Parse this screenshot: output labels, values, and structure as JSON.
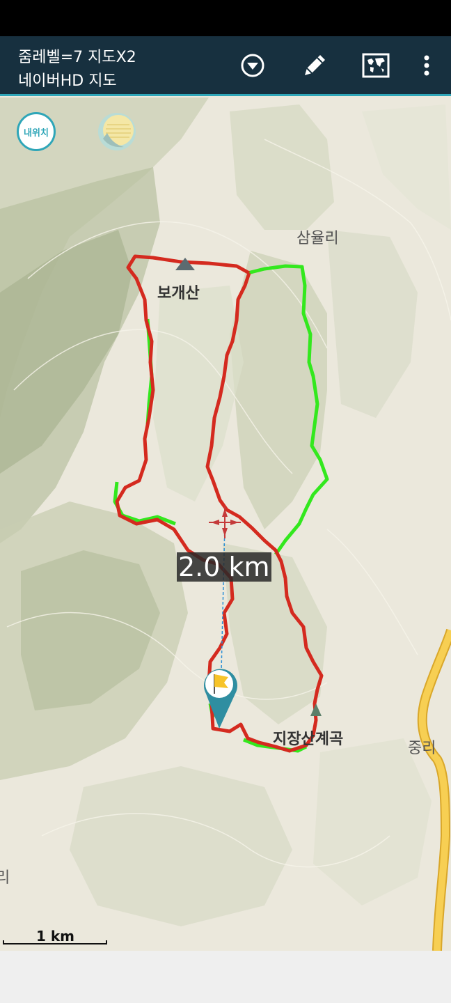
{
  "toolbar": {
    "zoom_label": "줌레벨=7 지도X2",
    "map_name": "네이버HD 지도"
  },
  "icons": {
    "dropdown": "dropdown-circle-icon",
    "edit": "pencil-icon",
    "map_view": "world-map-icon",
    "more": "more-vertical-icon"
  },
  "controls": {
    "my_location_label": "내위치"
  },
  "places": {
    "samyul": "삼율리",
    "bogaesan": "보개산",
    "jijangsan": "지장산계곡",
    "jungri": "중리",
    "edge_ri": "리"
  },
  "measure": {
    "distance": "2.0 km"
  },
  "scale": {
    "label": "1 km"
  },
  "colors": {
    "toolbar_bg": "#17303f",
    "accent": "#2fa6b8",
    "track_red": "#d42a1f",
    "track_green": "#33e81e",
    "road": "#f3c64a"
  }
}
